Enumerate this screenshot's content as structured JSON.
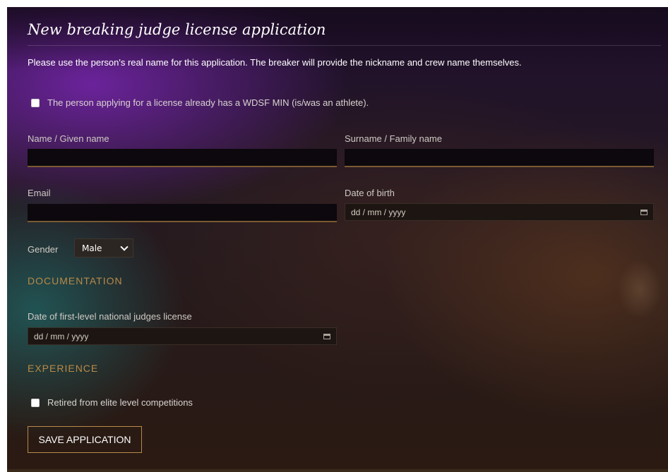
{
  "form": {
    "title": "New breaking judge license application",
    "intro": "Please use the person's real name for this application. The breaker will provide the nickname and crew name themselves.",
    "min_checkbox_label": "The person applying for a license already has a WDSF MIN (is/was an athlete).",
    "given_name": {
      "label": "Name / Given name",
      "value": ""
    },
    "surname": {
      "label": "Surname / Family name",
      "value": ""
    },
    "email": {
      "label": "Email",
      "value": ""
    },
    "date_of_birth": {
      "label": "Date of birth",
      "placeholder": "dd / mm / yyyy"
    },
    "gender": {
      "label": "Gender",
      "selected": "Male"
    },
    "documentation": {
      "heading": "DOCUMENTATION",
      "judge_license_date": {
        "label": "Date of first-level national judges license",
        "placeholder": "dd / mm / yyyy"
      }
    },
    "experience": {
      "heading": "EXPERIENCE",
      "retired_label": "Retired from elite level competitions"
    },
    "save_label": "SAVE APPLICATION"
  },
  "icons": {
    "calendar": "calendar-icon",
    "chevron": "chevron-down-icon",
    "checkbox": "checkbox"
  },
  "colors": {
    "accent": "#b88a48",
    "input_bg": "#0c080d",
    "title_text": "#ffffff"
  }
}
